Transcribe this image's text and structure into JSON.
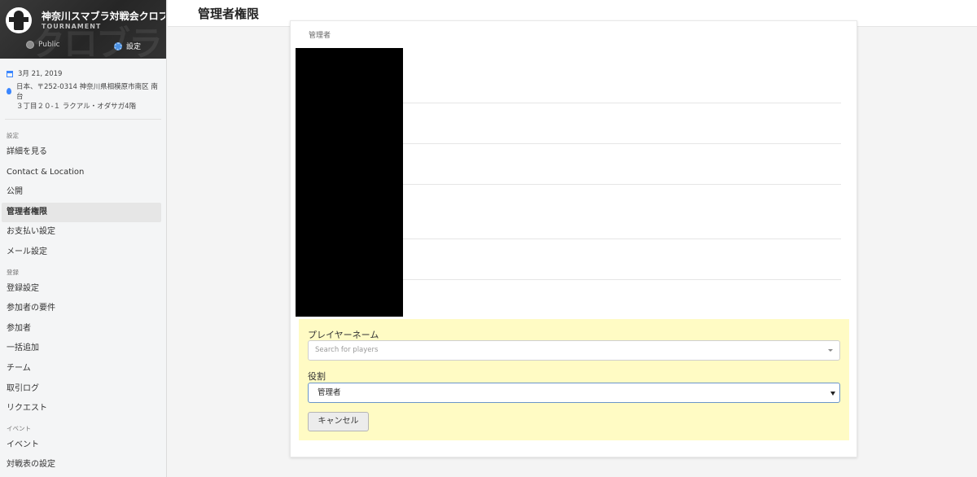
{
  "sidebar": {
    "banner": {
      "title": "神奈川スマブラ対戦会クロブラ",
      "subtitle": "TOURNAMENT",
      "public_label": "Public",
      "settings_label": "設定",
      "accent": "#4a90e2"
    },
    "date": "3月 21, 2019",
    "address_line1": "日本、〒252-0314 神奈川県相模原市南区 南台",
    "address_line2": "３丁目２０‐１ ラクアル・オダサガ4階",
    "sections": [
      {
        "heading": "設定",
        "items": [
          "詳細を見る",
          "Contact & Location",
          "公開",
          "管理者権限",
          "お支払い設定",
          "メール設定"
        ]
      },
      {
        "heading": "登録",
        "items": [
          "登録設定",
          "参加者の要件",
          "参加者",
          "一括追加",
          "チーム",
          "取引ログ",
          "リクエスト"
        ]
      },
      {
        "heading": "イベント",
        "items": [
          "イベント",
          "対戦表の設定"
        ]
      }
    ],
    "active_item": "管理者権限"
  },
  "header": {
    "title": "管理者権限"
  },
  "admins": {
    "column_header": "管理者"
  },
  "form": {
    "player_label": "プレイヤーネーム",
    "player_placeholder": "Search for players",
    "role_label": "役割",
    "role_value": "管理者",
    "cancel_label": "キャンセル",
    "background": "#fffbc4"
  }
}
